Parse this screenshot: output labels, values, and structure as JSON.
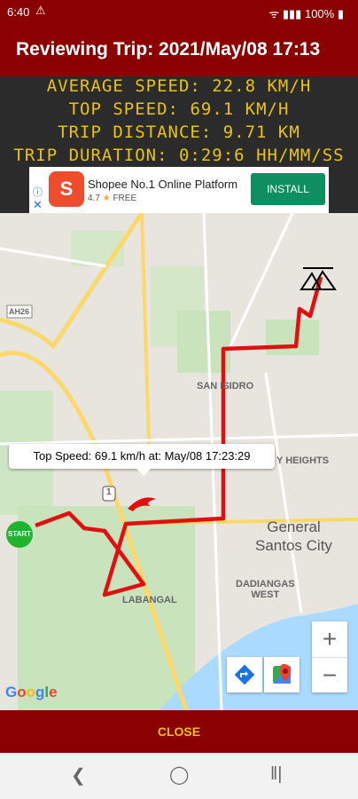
{
  "status": {
    "time": "6:40",
    "right": "100%"
  },
  "header": {
    "title": "Reviewing Trip: 2021/May/08 17:13"
  },
  "stats": {
    "average": "AVERAGE SPEED: 22.8 KM/H",
    "top": "TOP SPEED: 69.1 KM/H",
    "distance": "TRIP DISTANCE: 9.71 KM",
    "duration": "TRIP DURATION: 0:29:6 HH/MM/SS"
  },
  "ad": {
    "name": "Shopee No.1 Online Platform",
    "rating": "4.7",
    "price": "FREE",
    "install": "INSTALL",
    "logo_letter": "S",
    "icon": "shopee-bag-icon"
  },
  "map": {
    "labels": {
      "ah26": "AH26",
      "san_isidro": "SAN ISIDRO",
      "heights": "Y HEIGHTS",
      "labangal": "LABANGAL",
      "dadiangas": "DADIANGAS\nWEST",
      "city": "General\nSantos City",
      "highway": "1"
    },
    "tooltip": "Top Speed: 69.1 km/h at: May/08 17:23:29",
    "start": "START",
    "google": "Google",
    "zoom_in": "+",
    "zoom_out": "−"
  },
  "footer": {
    "close": "CLOSE"
  },
  "colors": {
    "header": "#8b0000",
    "stats_bg": "#2b2b2b",
    "stats_text": "#e9c21a",
    "route": "#e11010",
    "start": "#1fb32e",
    "install": "#0f8e5f"
  }
}
